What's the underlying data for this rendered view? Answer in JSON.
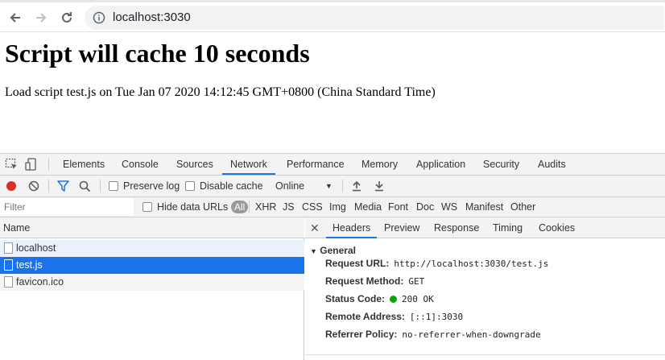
{
  "browser": {
    "url": "localhost:3030",
    "back_icon": "arrow-left-icon",
    "forward_icon": "arrow-right-icon",
    "reload_icon": "reload-icon",
    "info_icon": "info-icon"
  },
  "page": {
    "title": "Script will cache 10 seconds",
    "text": "Load script test.js on Tue Jan 07 2020 14:12:45 GMT+0800 (China Standard Time)"
  },
  "devtools": {
    "tabs": [
      "Elements",
      "Console",
      "Sources",
      "Network",
      "Performance",
      "Memory",
      "Application",
      "Security",
      "Audits"
    ],
    "active_tab": "Network",
    "toolbar": {
      "preserve_log": "Preserve log",
      "disable_cache": "Disable cache",
      "throttle": "Online"
    },
    "filter": {
      "placeholder": "Filter",
      "hide_data_urls": "Hide data URLs",
      "types": [
        "All",
        "XHR",
        "JS",
        "CSS",
        "Img",
        "Media",
        "Font",
        "Doc",
        "WS",
        "Manifest",
        "Other"
      ]
    },
    "requests": {
      "header": "Name",
      "rows": [
        "localhost",
        "test.js",
        "favicon.ico"
      ],
      "selected": "test.js"
    },
    "details": {
      "tabs": [
        "Headers",
        "Preview",
        "Response",
        "Timing",
        "Cookies"
      ],
      "active_tab": "Headers",
      "section": "General",
      "fields": [
        {
          "key": "Request URL:",
          "value": "http://localhost:3030/test.js"
        },
        {
          "key": "Request Method:",
          "value": "GET"
        },
        {
          "key": "Status Code:",
          "value": "200 OK"
        },
        {
          "key": "Remote Address:",
          "value": "[::1]:3030"
        },
        {
          "key": "Referrer Policy:",
          "value": "no-referrer-when-downgrade"
        }
      ],
      "status_color": "#0ca30a"
    },
    "colors": {
      "accent": "#1a73e8",
      "record": "#d93025",
      "filter_icon": "#1a73e8"
    }
  }
}
